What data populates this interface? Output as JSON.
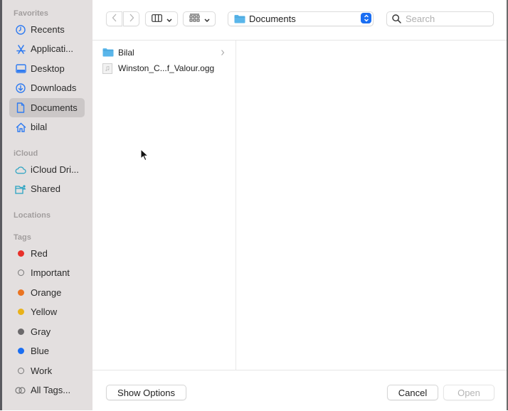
{
  "sidebar": {
    "sections": {
      "favorites": "Favorites",
      "icloud": "iCloud",
      "locations": "Locations",
      "tags": "Tags"
    },
    "favorites": [
      {
        "label": "Recents",
        "icon": "clock-icon"
      },
      {
        "label": "Applicati...",
        "icon": "applications-icon"
      },
      {
        "label": "Desktop",
        "icon": "desktop-icon"
      },
      {
        "label": "Downloads",
        "icon": "download-icon"
      },
      {
        "label": "Documents",
        "icon": "document-icon",
        "selected": true
      },
      {
        "label": "bilal",
        "icon": "home-icon"
      }
    ],
    "icloud": [
      {
        "label": "iCloud Dri...",
        "icon": "cloud-icon"
      },
      {
        "label": "Shared",
        "icon": "shared-folder-icon"
      }
    ],
    "tags": [
      {
        "label": "Red",
        "color": "#e8302a"
      },
      {
        "label": "Important",
        "color": null
      },
      {
        "label": "Orange",
        "color": "#ea7422"
      },
      {
        "label": "Yellow",
        "color": "#e9b21a"
      },
      {
        "label": "Gray",
        "color": "#6b696b"
      },
      {
        "label": "Blue",
        "color": "#1a6ef2"
      },
      {
        "label": "Work",
        "color": null
      },
      {
        "label": "All Tags...",
        "color": null
      }
    ]
  },
  "toolbar": {
    "back": "‹",
    "forward": "›",
    "location": "Documents",
    "search_placeholder": "Search"
  },
  "browser": {
    "column1": [
      {
        "name": "Bilal",
        "type": "folder",
        "has_children": true
      },
      {
        "name": "Winston_C...f_Valour.ogg",
        "type": "audio-file"
      }
    ]
  },
  "footer": {
    "show_options": "Show Options",
    "cancel": "Cancel",
    "open": "Open"
  },
  "colors": {
    "accent": "#1a6ef2",
    "folder": "#5ab6ea",
    "sidebar_bg": "#e3dfdf"
  }
}
